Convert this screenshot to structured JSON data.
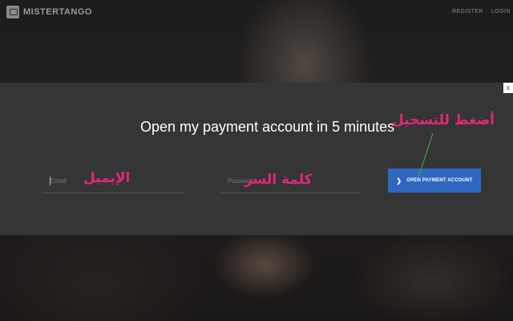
{
  "header": {
    "logo_text": "MISTERTANGO",
    "register_label": "REGISTER",
    "login_label": "LOGIN"
  },
  "modal": {
    "headline": "Open my payment account in 5 minutes",
    "email_placeholder": "Email",
    "password_placeholder": "Password",
    "cta_label": "OPEN PAYMENT ACCOUNT",
    "cta_icon": "chevron-right-icon",
    "close_label": "x"
  },
  "annotations": {
    "email_ar": "الإيميل",
    "password_ar": "كلمة السر",
    "cta_ar": "أضغط للتسجيل"
  },
  "colors": {
    "accent": "#2f67c0",
    "annotation": "#e0287a",
    "panel": "#353535"
  }
}
